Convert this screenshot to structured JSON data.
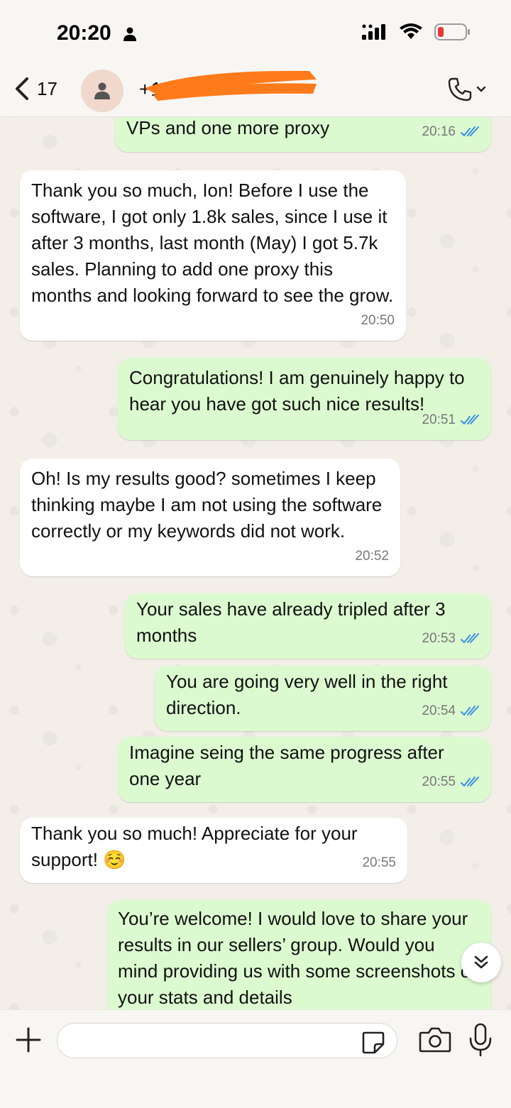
{
  "status_bar": {
    "time": "20:20",
    "person_icon": "person-icon",
    "signal_icon": "signal-bars-icon",
    "wifi_icon": "wifi-icon",
    "battery_icon": "battery-low-icon",
    "battery_color": "#e53935"
  },
  "header": {
    "back_count": "17",
    "contact_name": "+1",
    "avatar_icon": "person-icon",
    "call_icon": "phone-icon",
    "redaction_color": "#ff7a1a"
  },
  "messages": [
    {
      "direction": "out",
      "text": "VPs and one more proxy",
      "time": "20:16",
      "status": "read"
    },
    {
      "direction": "in",
      "text": "Thank you so much, Ion! Before I use the software, I got only 1.8k sales, since I use it after 3 months, last month (May) I got 5.7k sales. Planning to add one proxy this months and looking forward to see the grow.",
      "time": "20:50"
    },
    {
      "direction": "out",
      "text": "Congratulations! I am genuinely happy to hear you have got such nice results!",
      "time": "20:51",
      "status": "read"
    },
    {
      "direction": "in",
      "text": "Oh! Is my results good? sometimes I keep thinking maybe I am not using the software correctly or my keywords did not work.",
      "time": "20:52"
    },
    {
      "direction": "out",
      "text": "Your sales have already tripled after 3 months",
      "time": "20:53",
      "status": "read"
    },
    {
      "direction": "out",
      "text": "You are going very well in the right direction.",
      "time": "20:54",
      "status": "read"
    },
    {
      "direction": "out",
      "text": "Imagine seing the same progress after one year",
      "time": "20:55",
      "status": "read"
    },
    {
      "direction": "in",
      "text": "Thank you so much! Appreciate for your support! ☺️",
      "time": "20:55"
    },
    {
      "direction": "out",
      "text": "You’re welcome! I would love to share your results in our sellers’ group. Would you mind providing us with some screenshots of your stats and details",
      "time": "",
      "status": ""
    }
  ],
  "colors": {
    "outgoing_bubble": "#dcfad0",
    "incoming_bubble": "#ffffff",
    "read_ticks": "#3b8ee8"
  },
  "input": {
    "placeholder": "",
    "plus_icon": "plus-icon",
    "sticker_icon": "sticker-icon",
    "camera_icon": "camera-icon",
    "mic_icon": "microphone-icon"
  },
  "scroll_down_icon": "double-chevron-down-icon"
}
